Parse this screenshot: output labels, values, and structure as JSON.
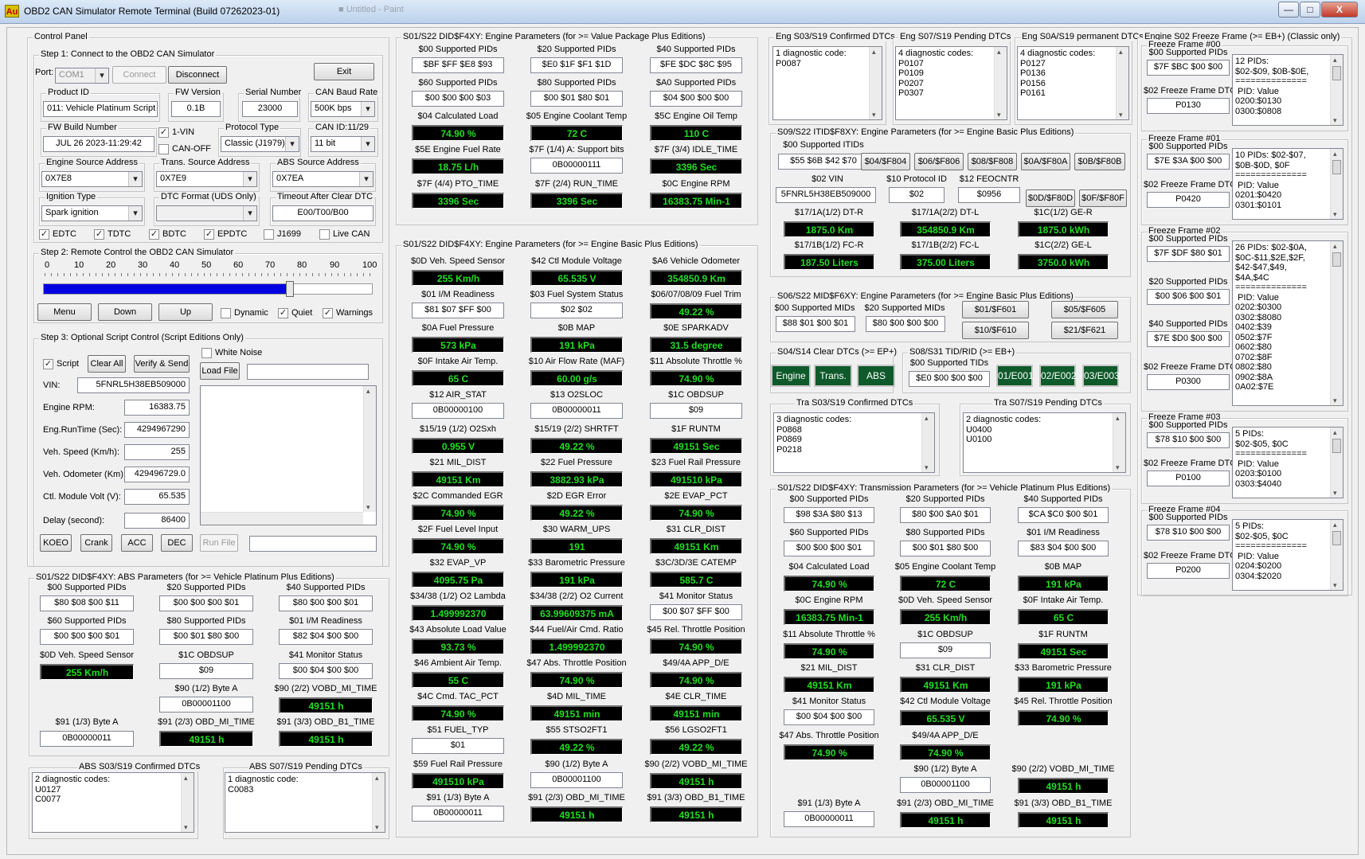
{
  "window": {
    "title": "OBD2 CAN Simulator Remote Terminal (Build 07262023-01)",
    "icon": "Au",
    "min": "—",
    "max": "□",
    "close": "X",
    "ghost": "■ Untitled - Paint"
  },
  "control": {
    "title": "Control Panel",
    "step1": "Step 1: Connect to the OBD2 CAN Simulator",
    "port_label": "Port:",
    "port": "COM1",
    "connect": "Connect",
    "disconnect": "Disconnect",
    "exit": "Exit",
    "product_id_label": "Product ID",
    "product_id": "011: Vehicle Platinum Script",
    "fw_version_label": "FW Version",
    "fw_version": "0.1B",
    "serial_label": "Serial Number",
    "serial": "23000",
    "baud_label": "CAN Baud Rate",
    "baud": "500K bps",
    "fw_build_label": "FW Build Number",
    "fw_build": "JUL 26 2023-11:29:42",
    "one_vin": "1-VIN",
    "can_off": "CAN-OFF",
    "protocol_label": "Protocol Type",
    "protocol": "Classic (J1979)",
    "canid_label": "CAN ID:11/29",
    "canid": "11 bit",
    "eng_addr_label": "Engine Source Address",
    "eng_addr": "0X7E8",
    "trans_addr_label": "Trans. Source Address",
    "trans_addr": "0X7E9",
    "abs_addr_label": "ABS Source Address",
    "abs_addr": "0X7EA",
    "ign_label": "Ignition Type",
    "ign": "Spark ignition",
    "dtc_format_label": "DTC Format (UDS Only)",
    "timeout_label": "Timeout After Clear DTC",
    "timeout": "E00/T00/B00",
    "checks": [
      "EDTC",
      "TDTC",
      "BDTC",
      "EPDTC",
      "J1699",
      "Live CAN"
    ],
    "step2": "Step 2: Remote Control the OBD2 CAN Simulator",
    "scale": [
      "0",
      "10",
      "20",
      "30",
      "40",
      "50",
      "60",
      "70",
      "80",
      "90",
      "100"
    ],
    "slider_level": 0.75,
    "menu": "Menu",
    "down": "Down",
    "up": "Up",
    "dynamic": "Dynamic",
    "quiet": "Quiet",
    "warnings": "Warnings",
    "step3": "Step 3: Optional Script Control (Script Editions Only)",
    "script": "Script",
    "clear_all": "Clear All",
    "verify_send": "Verify & Send",
    "white_noise": "White Noise",
    "load_file": "Load File",
    "vin_label": "VIN:",
    "vin": "5FNRL5H38EB509000",
    "rpm_label": "Engine RPM:",
    "rpm": "16383.75",
    "runtime_label": "Eng.RunTime (Sec):",
    "runtime": "4294967290",
    "speed_label": "Veh. Speed (Km/h):",
    "speed": "255",
    "odo_label": "Veh. Odometer (Km):",
    "odo": "429496729.0",
    "volt_label": "Ctl. Module Volt (V):",
    "volt": "65.535",
    "delay_label": "Delay (second):",
    "delay": "86400",
    "koeo": "KOEO",
    "crank": "Crank",
    "acc": "ACC",
    "dec": "DEC",
    "run_file": "Run File"
  },
  "abs_params": {
    "title": "S01/S22 DID$F4XY: ABS Parameters (for >= Vehicle Platinum Plus Editions)",
    "pid00_l": "$00 Supported PIDs",
    "pid00": "$80 $08 $00 $11",
    "pid20_l": "$20 Supported PIDs",
    "pid20": "$00 $00 $00 $01",
    "pid40_l": "$40 Supported PIDs",
    "pid40": "$80 $00 $00 $01",
    "pid60_l": "$60 Supported PIDs",
    "pid60": "$00 $00 $00 $01",
    "pid80_l": "$80 Supported PIDs",
    "pid80": "$00 $01 $80 $00",
    "pid01_l": "$01 I/M Readiness",
    "pid01": "$82 $04 $00 $00",
    "speed_l": "$0D Veh. Speed Sensor",
    "speed": "255 Km/h",
    "obdsup_l": "$1C OBDSUP",
    "obdsup": "$09",
    "monstat_l": "$41 Monitor Status",
    "monstat": "$00 $04 $00 $00",
    "b90_l": "$90 (1/2) Byte A",
    "b90": "0B00001100",
    "vobd_l": "$90 (2/2) VOBD_MI_TIME",
    "vobd": "49151 h",
    "b91_l": "$91 (1/3) Byte A",
    "b91": "0B00000011",
    "obdmi_l": "$91 (2/3) OBD_MI_TIME",
    "obdmi": "49151 h",
    "obdb1_l": "$91 (3/3) OBD_B1_TIME",
    "obdb1": "49151 h"
  },
  "abs_dtc": {
    "conf_title": "ABS S03/S19 Confirmed DTCs",
    "conf": "2 diagnostic codes:\nU0127\nC0077",
    "pend_title": "ABS S07/S19 Pending DTCs",
    "pend": "1 diagnostic code:\nC0083"
  },
  "value_pkg": {
    "title": "S01/S22 DID$F4XY: Engine Parameters (for >= Value Package Plus Editions)",
    "p00_l": "$00 Supported PIDs",
    "p00": "$BF $FF $E8 $93",
    "p20_l": "$20 Supported PIDs",
    "p20": "$E0 $1F $F1 $1D",
    "p40_l": "$40 Supported PIDs",
    "p40": "$FE $DC $8C $95",
    "p60_l": "$60 Supported PIDs",
    "p60": "$00 $00 $00 $03",
    "p80_l": "$80 Supported PIDs",
    "p80": "$00 $01 $80 $01",
    "pA0_l": "$A0 Supported PIDs",
    "pA0": "$04 $00 $00 $00",
    "load_l": "$04 Calculated Load",
    "load": "74.90 %",
    "cool_l": "$05 Engine Coolant Temp",
    "cool": "72 C",
    "oil_l": "$5C Engine Oil Temp",
    "oil": "110 C",
    "fuel_l": "$5E Engine Fuel Rate",
    "fuel": "18.75 L/h",
    "sup7f_l": "$7F (1/4) A: Support bits",
    "sup7f": "0B00000111",
    "idle_l": "$7F (3/4) IDLE_TIME",
    "idle": "3396 Sec",
    "pto_l": "$7F (4/4) PTO_TIME",
    "pto": "3396 Sec",
    "run_l": "$7F (2/4) RUN_TIME",
    "run": "3396 Sec",
    "rpm_l": "$0C Engine RPM",
    "rpm": "16383.75 Min-1"
  },
  "basic_params": {
    "title": "S01/S22 DID$F4XY: Engine Parameters (for >= Engine Basic Plus Editions)",
    "items": [
      {
        "l": "$0D Veh. Speed Sensor",
        "v": "255 Km/h",
        "k": "lcd"
      },
      {
        "l": "$42 Ctl Module Voltage",
        "v": "65.535 V",
        "k": "lcd"
      },
      {
        "l": "$A6 Vehicle Odometer",
        "v": "354850.9 Km",
        "k": "lcd"
      },
      {
        "l": "$01 I/M Readiness",
        "v": "$81 $07 $FF $00",
        "k": "tb"
      },
      {
        "l": "$03 Fuel System Status",
        "v": "$02 $02",
        "k": "tb"
      },
      {
        "l": "$06/07/08/09 Fuel Trim",
        "v": "49.22 %",
        "k": "lcd"
      },
      {
        "l": "$0A Fuel Pressure",
        "v": "573 kPa",
        "k": "lcd"
      },
      {
        "l": "$0B MAP",
        "v": "191 kPa",
        "k": "lcd"
      },
      {
        "l": "$0E SPARKADV",
        "v": "31.5 degree",
        "k": "lcd"
      },
      {
        "l": "$0F Intake Air Temp.",
        "v": "65 C",
        "k": "lcd"
      },
      {
        "l": "$10 Air Flow Rate (MAF)",
        "v": "60.00 g/s",
        "k": "lcd"
      },
      {
        "l": "$11 Absolute Throttle %",
        "v": "74.90 %",
        "k": "lcd"
      },
      {
        "l": "$12 AIR_STAT",
        "v": "0B00000100",
        "k": "tb"
      },
      {
        "l": "$13 O2SLOC",
        "v": "0B00000011",
        "k": "tb"
      },
      {
        "l": "$1C OBDSUP",
        "v": "$09",
        "k": "tb"
      },
      {
        "l": "$15/19 (1/2) O2Sxh",
        "v": "0.955 V",
        "k": "lcd"
      },
      {
        "l": "$15/19 (2/2) SHRTFT",
        "v": "49.22 %",
        "k": "lcd"
      },
      {
        "l": "$1F RUNTM",
        "v": "49151 Sec",
        "k": "lcd"
      },
      {
        "l": "$21 MIL_DIST",
        "v": "49151 Km",
        "k": "lcd"
      },
      {
        "l": "$22 Fuel Pressure",
        "v": "3882.93 kPa",
        "k": "lcd"
      },
      {
        "l": "$23 Fuel Rail Pressure",
        "v": "491510 kPa",
        "k": "lcd"
      },
      {
        "l": "$2C Commanded EGR",
        "v": "74.90 %",
        "k": "lcd"
      },
      {
        "l": "$2D EGR Error",
        "v": "49.22 %",
        "k": "lcd"
      },
      {
        "l": "$2E EVAP_PCT",
        "v": "74.90 %",
        "k": "lcd"
      },
      {
        "l": "$2F Fuel Level Input",
        "v": "74.90 %",
        "k": "lcd"
      },
      {
        "l": "$30 WARM_UPS",
        "v": "191",
        "k": "lcd"
      },
      {
        "l": "$31 CLR_DIST",
        "v": "49151 Km",
        "k": "lcd"
      },
      {
        "l": "$32 EVAP_VP",
        "v": "4095.75 Pa",
        "k": "lcd"
      },
      {
        "l": "$33 Barometric Pressure",
        "v": "191 kPa",
        "k": "lcd"
      },
      {
        "l": "$3C/3D/3E CATEMP",
        "v": "585.7 C",
        "k": "lcd"
      },
      {
        "l": "$34/38 (1/2) O2 Lambda",
        "v": "1.499992370",
        "k": "lcd"
      },
      {
        "l": "$34/38 (2/2) O2 Current",
        "v": "63.99609375 mA",
        "k": "lcd"
      },
      {
        "l": "$41 Monitor Status",
        "v": "$00 $07 $FF $00",
        "k": "tb"
      },
      {
        "l": "$43 Absolute Load Value",
        "v": "93.73 %",
        "k": "lcd"
      },
      {
        "l": "$44 Fuel/Air Cmd. Ratio",
        "v": "1.499992370",
        "k": "lcd"
      },
      {
        "l": "$45 Rel. Throttle Position",
        "v": "74.90 %",
        "k": "lcd"
      },
      {
        "l": "$46 Ambient Air Temp.",
        "v": "55 C",
        "k": "lcd"
      },
      {
        "l": "$47 Abs. Throttle Position",
        "v": "74.90 %",
        "k": "lcd"
      },
      {
        "l": "$49/4A APP_D/E",
        "v": "74.90 %",
        "k": "lcd"
      },
      {
        "l": "$4C Cmd. TAC_PCT",
        "v": "74.90 %",
        "k": "lcd"
      },
      {
        "l": "$4D MIL_TIME",
        "v": "49151 min",
        "k": "lcd"
      },
      {
        "l": "$4E CLR_TIME",
        "v": "49151 min",
        "k": "lcd"
      },
      {
        "l": "$51 FUEL_TYP",
        "v": "$01",
        "k": "tb"
      },
      {
        "l": "$55 STSO2FT1",
        "v": "49.22 %",
        "k": "lcd"
      },
      {
        "l": "$56 LGSO2FT1",
        "v": "49.22 %",
        "k": "lcd"
      },
      {
        "l": "$59 Fuel Rail Pressure",
        "v": "491510 kPa",
        "k": "lcd"
      },
      {
        "l": "$90 (1/2) Byte A",
        "v": "0B00001100",
        "k": "tb"
      },
      {
        "l": "$90 (2/2) VOBD_MI_TIME",
        "v": "49151 h",
        "k": "lcd"
      },
      {
        "l": "$91 (1/3) Byte A",
        "v": "0B00000011",
        "k": "tb"
      },
      {
        "l": "$91 (2/3) OBD_MI_TIME",
        "v": "49151 h",
        "k": "lcd"
      },
      {
        "l": "$91 (3/3) OBD_B1_TIME",
        "v": "49151 h",
        "k": "lcd"
      }
    ]
  },
  "eng_dtc": {
    "conf_title": "Eng S03/S19 Confirmed DTCs",
    "conf": "1 diagnostic code:\nP0087",
    "pend_title": "Eng S07/S19 Pending DTCs",
    "pend": "4 diagnostic codes:\nP0107\nP0109\nP0207\nP0307",
    "perm_title": "Eng S0A/S19 permanent DTCs",
    "perm": "4 diagnostic codes:\nP0127\nP0136\nP0156\nP0161"
  },
  "itid": {
    "title": "S09/S22 ITID$F8XY: Engine Parameters (for >= Engine Basic Plus Editions)",
    "sup_l": "$00 Supported ITIDs",
    "sup": "$55 $6B $42 $70",
    "buttons": [
      "$04/$F804",
      "$06/$F806",
      "$08/$F808",
      "$0A/$F80A",
      "$0B/$F80B"
    ],
    "vin_l": "$02 VIN",
    "vin": "5FNRL5H38EB509000",
    "proto_l": "$10 Protocol ID",
    "proto": "$02",
    "feo_l": "$12 FEOCNTR",
    "feo": "$0956",
    "btn_0d": "$0D/$F80D",
    "btn_0f": "$0F/$F80F",
    "dtr_l": "$17/1A(1/2) DT-R",
    "dtr": "1875.0 Km",
    "dtl_l": "$17/1A(2/2) DT-L",
    "dtl": "354850.9 Km",
    "ger_l": "$1C(1/2) GE-R",
    "ger": "1875.0 kWh",
    "fcr_l": "$17/1B(1/2) FC-R",
    "fcr": "187.50 Liters",
    "fcl_l": "$17/1B(2/2) FC-L",
    "fcl": "375.00 Liters",
    "gel_l": "$1C(2/2) GE-L",
    "gel": "3750.0 kWh"
  },
  "mid": {
    "title": "S06/S22 MID$F6XY: Engine Parameters (for >= Engine Basic Plus Editions)",
    "m00_l": "$00 Supported MIDs",
    "m00": "$88 $01 $00 $01",
    "m20_l": "$20 Supported MIDs",
    "m20": "$80 $00 $00 $00",
    "b01": "$01/$F601",
    "b05": "$05/$F605",
    "b10": "$10/$F610",
    "b21": "$21/$F621"
  },
  "clear": {
    "title": "S04/S14 Clear DTCs (>= EP+)",
    "engine": "Engine",
    "trans": "Trans.",
    "abs": "ABS"
  },
  "tid": {
    "title": "S08/S31 TID/RID (>= EB+)",
    "sup_l": "$00 Supported TIDs",
    "sup": "$E0 $00 $00 $00",
    "b1": "01/E001",
    "b2": "02/E002",
    "b3": "03/E003"
  },
  "tra_dtc": {
    "conf_title": "Tra S03/S19 Confirmed DTCs",
    "conf": "3 diagnostic codes:\nP0868\nP0869\nP0218",
    "pend_title": "Tra S07/S19 Pending DTCs",
    "pend": "2 diagnostic codes:\nU0400\nU0100"
  },
  "trans_params": {
    "title": "S01/S22 DID$F4XY: Transmission Parameters (for >= Vehicle Platinum Plus Editions)",
    "items": [
      {
        "l": "$00 Supported PIDs",
        "v": "$98 $3A $80 $13",
        "k": "tb"
      },
      {
        "l": "$20 Supported PIDs",
        "v": "$80 $00 $A0 $01",
        "k": "tb"
      },
      {
        "l": "$40 Supported PIDs",
        "v": "$CA $C0 $00 $01",
        "k": "tb"
      },
      {
        "l": "$60 Supported PIDs",
        "v": "$00 $00 $00 $01",
        "k": "tb"
      },
      {
        "l": "$80 Supported PIDs",
        "v": "$00 $01 $80 $00",
        "k": "tb"
      },
      {
        "l": "$01 I/M Readiness",
        "v": "$83 $04 $00 $00",
        "k": "tb"
      },
      {
        "l": "$04 Calculated Load",
        "v": "74.90 %",
        "k": "lcd"
      },
      {
        "l": "$05 Engine Coolant Temp",
        "v": "72 C",
        "k": "lcd"
      },
      {
        "l": "$0B MAP",
        "v": "191 kPa",
        "k": "lcd"
      },
      {
        "l": "$0C Engine RPM",
        "v": "16383.75 Min-1",
        "k": "lcd"
      },
      {
        "l": "$0D Veh. Speed Sensor",
        "v": "255 Km/h",
        "k": "lcd"
      },
      {
        "l": "$0F Intake Air Temp.",
        "v": "65 C",
        "k": "lcd"
      },
      {
        "l": "$11 Absolute Throttle %",
        "v": "74.90 %",
        "k": "lcd"
      },
      {
        "l": "$1C OBDSUP",
        "v": "$09",
        "k": "tb"
      },
      {
        "l": "$1F RUNTM",
        "v": "49151 Sec",
        "k": "lcd"
      },
      {
        "l": "$21 MIL_DIST",
        "v": "49151 Km",
        "k": "lcd"
      },
      {
        "l": "$31 CLR_DIST",
        "v": "49151 Km",
        "k": "lcd"
      },
      {
        "l": "$33 Barometric Pressure",
        "v": "191 kPa",
        "k": "lcd"
      },
      {
        "l": "$41 Monitor Status",
        "v": "$00 $04 $00 $00",
        "k": "tb"
      },
      {
        "l": "$42 Ctl Module Voltage",
        "v": "65.535 V",
        "k": "lcd"
      },
      {
        "l": "$45 Rel. Throttle Position",
        "v": "74.90 %",
        "k": "lcd"
      },
      {
        "l": "$47 Abs. Throttle Position",
        "v": "74.90 %",
        "k": "lcd"
      },
      {
        "l": "$49/4A APP_D/E",
        "v": "74.90 %",
        "k": "lcd"
      },
      null,
      null,
      {
        "l": "$90 (1/2) Byte A",
        "v": "0B00001100",
        "k": "tb"
      },
      {
        "l": "$90 (2/2) VOBD_MI_TIME",
        "v": "49151 h",
        "k": "lcd"
      },
      {
        "l": "$91 (1/3) Byte A",
        "v": "0B00000011",
        "k": "tb"
      },
      {
        "l": "$91 (2/3) OBD_MI_TIME",
        "v": "49151 h",
        "k": "lcd"
      },
      {
        "l": "$91 (3/3) OBD_B1_TIME",
        "v": "49151 h",
        "k": "lcd"
      }
    ]
  },
  "freeze": {
    "title": "Engine S02 Freeze Frame (>= EB+) (Classic only)",
    "frames": [
      {
        "name": "Freeze Frame #00",
        "rows": [
          {
            "l": "$00 Supported PIDs",
            "v": "$7F $BC $00 $00"
          },
          {
            "l": "$02 Freeze Frame DTC",
            "v": "P0130"
          }
        ],
        "list": "12 PIDs:\n$02-$09, $0B-$0E,\n==============\n PID: Value\n0200:$0130\n0300:$0808"
      },
      {
        "name": "Freeze Frame #01",
        "rows": [
          {
            "l": "$00 Supported PIDs",
            "v": "$7E $3A $00 $00"
          },
          {
            "l": "$02 Freeze Frame DTC",
            "v": "P0420"
          }
        ],
        "list": "10 PIDs: $02-$07,\n$0B-$0D, $0F\n==============\n PID: Value\n0201:$0420\n0301:$0101"
      },
      {
        "name": "Freeze Frame #02",
        "rows": [
          {
            "l": "$00 Supported PIDs",
            "v": "$7F $DF $80 $01"
          },
          {
            "l": "$20 Supported PIDs",
            "v": "$00 $06 $00 $01"
          },
          {
            "l": "$40 Supported PIDs",
            "v": "$7E $D0 $00 $00"
          },
          {
            "l": "$02 Freeze Frame DTC",
            "v": "P0300"
          }
        ],
        "list": "26 PIDs: $02-$0A,\n$0C-$11,$2E,$2F,\n$42-$47,$49,\n$4A,$4C\n==============\n PID: Value\n0202:$0300\n0302:$8080\n0402:$39\n0502:$7F\n0602:$80\n0702:$8F\n0802:$80\n0902:$8A\n0A02:$7E"
      },
      {
        "name": "Freeze Frame #03",
        "rows": [
          {
            "l": "$00 Supported PIDs",
            "v": "$78 $10 $00 $00"
          },
          {
            "l": "$02 Freeze Frame DTC",
            "v": "P0100"
          }
        ],
        "list": "5 PIDs:\n$02-$05, $0C\n==============\n PID: Value\n0203:$0100\n0303:$4040"
      },
      {
        "name": "Freeze Frame #04",
        "rows": [
          {
            "l": "$00 Supported PIDs",
            "v": "$78 $10 $00 $00"
          },
          {
            "l": "$02 Freeze Frame DTC",
            "v": "P0200"
          }
        ],
        "list": "5 PIDs:\n$02-$05, $0C\n==============\n PID: Value\n0204:$0200\n0304:$2020"
      }
    ]
  },
  "colors": {
    "lcd_bg": "#000000",
    "lcd_fg": "#22dd22",
    "slider": "#0000e0",
    "green_button": "#0f5a2a"
  }
}
